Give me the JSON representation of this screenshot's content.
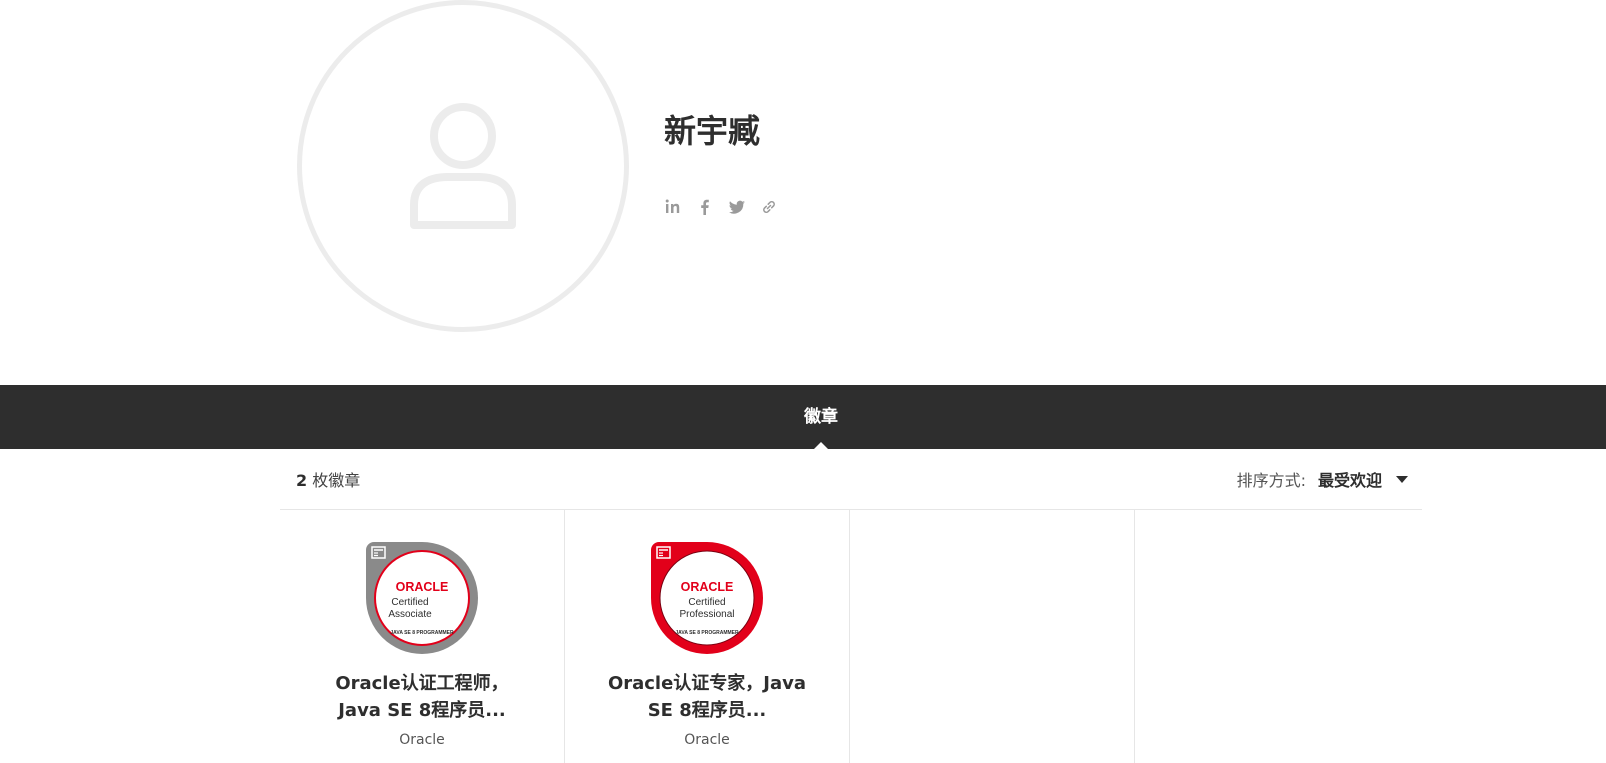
{
  "profile": {
    "name": "新宇臧",
    "social": [
      "linkedin-icon",
      "facebook-icon",
      "twitter-icon",
      "link-icon"
    ]
  },
  "tabs": [
    {
      "label": "徽章",
      "active": true
    }
  ],
  "toolbar": {
    "count_number": "2",
    "count_suffix": " 枚徽章",
    "sort_label": "排序方式:",
    "sort_value": "最受欢迎"
  },
  "badges": [
    {
      "title": "Oracle认证工程师，Java SE 8程序员...",
      "issuer": "Oracle",
      "brand": "ORACLE",
      "line1": "Certified",
      "line2": "Associate",
      "ring_text": "JAVA SE 8 PROGRAMMER",
      "ring_color": "#8a8a8a"
    },
    {
      "title": "Oracle认证专家，Java SE 8程序员...",
      "issuer": "Oracle",
      "brand": "ORACLE",
      "line1": "Certified",
      "line2": "Professional",
      "ring_text": "JAVA SE 8 PROGRAMMER",
      "ring_color": "#e2001a"
    }
  ],
  "colors": {
    "brand_red": "#e2001a",
    "tabbar": "#2e2e2e"
  }
}
